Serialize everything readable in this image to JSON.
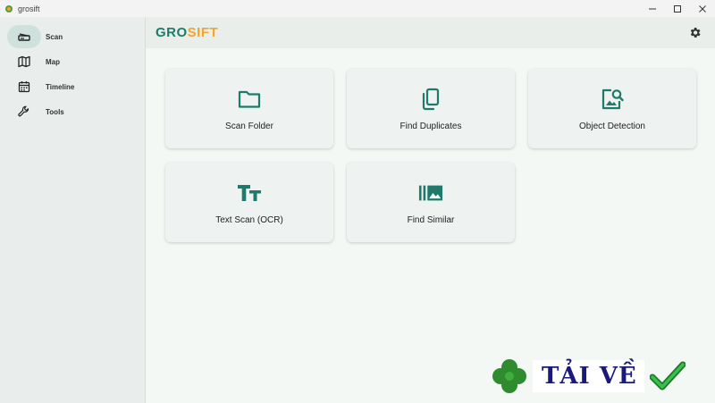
{
  "window": {
    "title": "grosift"
  },
  "sidebar": {
    "items": [
      {
        "label": "Scan",
        "icon": "scanner-icon",
        "active": true
      },
      {
        "label": "Map",
        "icon": "map-icon",
        "active": false
      },
      {
        "label": "Timeline",
        "icon": "calendar-icon",
        "active": false
      },
      {
        "label": "Tools",
        "icon": "wrench-icon",
        "active": false
      }
    ]
  },
  "header": {
    "logo_part1": "GRO",
    "logo_part2": "SIFT",
    "settings_icon": "gear-icon"
  },
  "cards": [
    {
      "label": "Scan Folder",
      "icon": "folder-icon"
    },
    {
      "label": "Find Duplicates",
      "icon": "duplicate-icon"
    },
    {
      "label": "Object Detection",
      "icon": "image-search-icon"
    },
    {
      "label": "Text Scan (OCR)",
      "icon": "text-size-icon"
    },
    {
      "label": "Find Similar",
      "icon": "similar-images-icon"
    }
  ],
  "watermark": {
    "text": "TẢI VỀ"
  },
  "colors": {
    "accent": "#1f7a6b",
    "logo_highlight": "#f3a42a",
    "active_pill": "#cfe1dc"
  }
}
